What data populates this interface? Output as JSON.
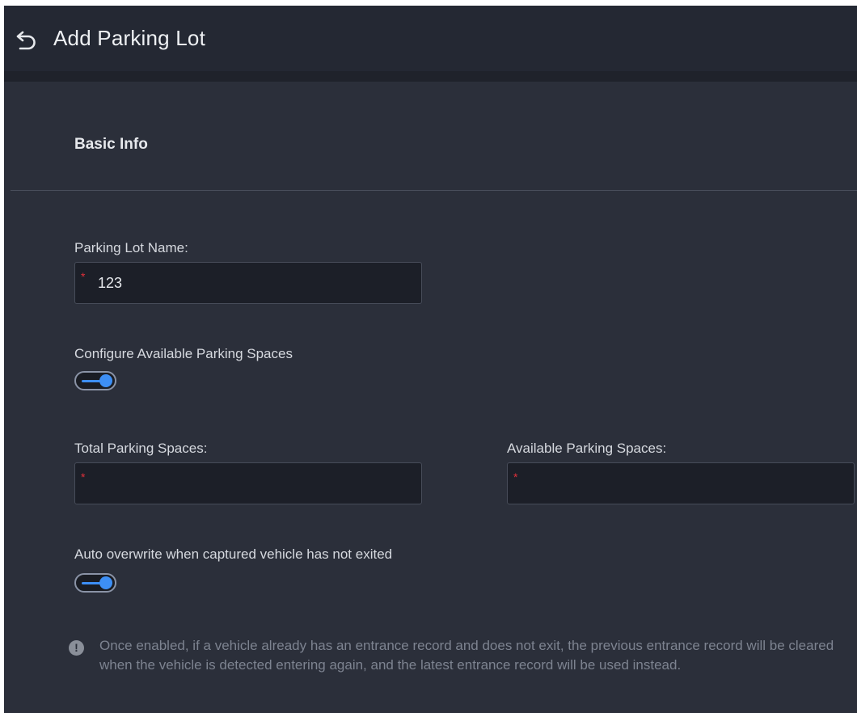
{
  "header": {
    "back_icon": "undo-arrow-icon",
    "title": "Add Parking Lot"
  },
  "section": {
    "title": "Basic Info"
  },
  "form": {
    "parking_lot_name": {
      "label": "Parking Lot Name:",
      "value": "123",
      "required_mark": "*"
    },
    "configure_available": {
      "label": "Configure Available Parking Spaces",
      "enabled": true
    },
    "total_spaces": {
      "label": "Total Parking Spaces:",
      "value": "",
      "required_mark": "*"
    },
    "available_spaces": {
      "label": "Available Parking Spaces:",
      "value": "",
      "required_mark": "*"
    },
    "auto_overwrite": {
      "label": "Auto overwrite when captured vehicle has not exited",
      "enabled": true
    }
  },
  "hint": {
    "icon": "info-icon",
    "icon_glyph": "!",
    "text": "Once enabled, if a vehicle already has an entrance record and does not exit, the previous entrance record will be cleared when the vehicle is detected entering again, and the latest entrance record will be used instead."
  },
  "colors": {
    "background": "#2b2f3a",
    "header": "#242833",
    "input_bg": "#1c1f28",
    "accent": "#3d8ff5",
    "required": "#e0303a",
    "hint_text": "#7d8390"
  }
}
